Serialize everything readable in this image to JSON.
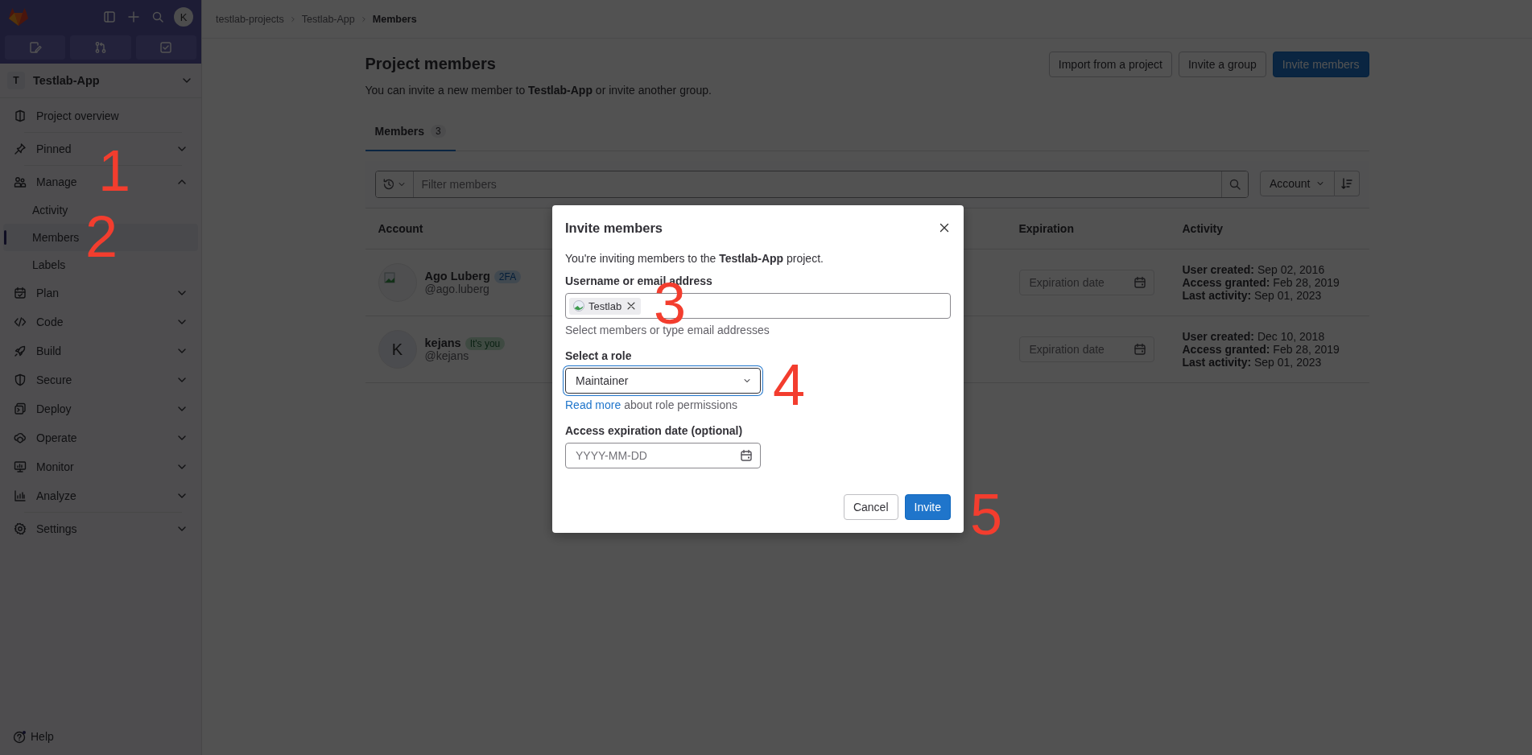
{
  "sidebar": {
    "avatar_letter": "K",
    "project": {
      "letter": "T",
      "name": "Testlab-App"
    },
    "items": [
      {
        "label": "Project overview",
        "kind": "link"
      },
      {
        "label": "Pinned",
        "kind": "section",
        "expanded": false
      },
      {
        "label": "Manage",
        "kind": "section",
        "expanded": true,
        "children": [
          {
            "label": "Activity",
            "selected": false
          },
          {
            "label": "Members",
            "selected": true
          },
          {
            "label": "Labels",
            "selected": false
          }
        ]
      },
      {
        "label": "Plan",
        "kind": "section",
        "expanded": false
      },
      {
        "label": "Code",
        "kind": "section",
        "expanded": false
      },
      {
        "label": "Build",
        "kind": "section",
        "expanded": false
      },
      {
        "label": "Secure",
        "kind": "section",
        "expanded": false
      },
      {
        "label": "Deploy",
        "kind": "section",
        "expanded": false
      },
      {
        "label": "Operate",
        "kind": "section",
        "expanded": false
      },
      {
        "label": "Monitor",
        "kind": "section",
        "expanded": false
      },
      {
        "label": "Analyze",
        "kind": "section",
        "expanded": false
      },
      {
        "label": "Settings",
        "kind": "section",
        "expanded": false
      }
    ],
    "help": "Help"
  },
  "breadcrumbs": [
    {
      "label": "testlab-projects",
      "current": false
    },
    {
      "label": "Testlab-App",
      "current": false
    },
    {
      "label": "Members",
      "current": true
    }
  ],
  "page": {
    "title": "Project members",
    "description": "You can invite a new member to **Testlab-App** or invite another group.",
    "buttons": [
      {
        "label": "Import from a project",
        "kind": "secondary"
      },
      {
        "label": "Invite a group",
        "kind": "secondary"
      },
      {
        "label": "Invite members",
        "kind": "primary"
      }
    ]
  },
  "tabs": [
    {
      "label": "Members",
      "count": "3",
      "selected": true
    }
  ],
  "filter": {
    "placeholder": "Filter members",
    "sort_label": "Account"
  },
  "table": {
    "columns": [
      "Account",
      "Expiration",
      "Activity"
    ],
    "rows": [
      {
        "avatar": {
          "kind": "image"
        },
        "name": "Ago Luberg",
        "badge": {
          "label": "2FA",
          "kind": "info"
        },
        "username": "@ago.luberg",
        "expiration_placeholder": "Expiration date",
        "activity": [
          "**User created:** Sep 02, 2016",
          "**Access granted:** Feb 28, 2019",
          "**Last activity:** Sep 01, 2023"
        ]
      },
      {
        "avatar": {
          "kind": "letter",
          "letter": "K"
        },
        "name": "kejans",
        "badge": {
          "label": "It's you",
          "kind": "success"
        },
        "username": "@kejans",
        "expiration_placeholder": "Expiration date",
        "activity": [
          "**User created:** Dec 10, 2018",
          "**Access granted:** Feb 28, 2019",
          "**Last activity:** Sep 01, 2023"
        ]
      }
    ]
  },
  "modal": {
    "title": "Invite members",
    "intro": "You're inviting members to the **Testlab-App** project.",
    "username_label": "Username or email address",
    "tokens": [
      {
        "label": "Testlab"
      }
    ],
    "username_help": "Select members or type email addresses",
    "role_label": "Select a role",
    "role_value": "Maintainer",
    "role_help_link": "Read more",
    "role_help_text": "about role permissions",
    "date_label": "Access expiration date (optional)",
    "date_placeholder": "YYYY-MM-DD",
    "buttons": [
      {
        "label": "Cancel",
        "kind": "secondary"
      },
      {
        "label": "Invite",
        "kind": "primary"
      }
    ]
  },
  "annotations": [
    {
      "text": "1"
    },
    {
      "text": "2"
    },
    {
      "text": "3"
    },
    {
      "text": "4"
    },
    {
      "text": "5"
    }
  ]
}
